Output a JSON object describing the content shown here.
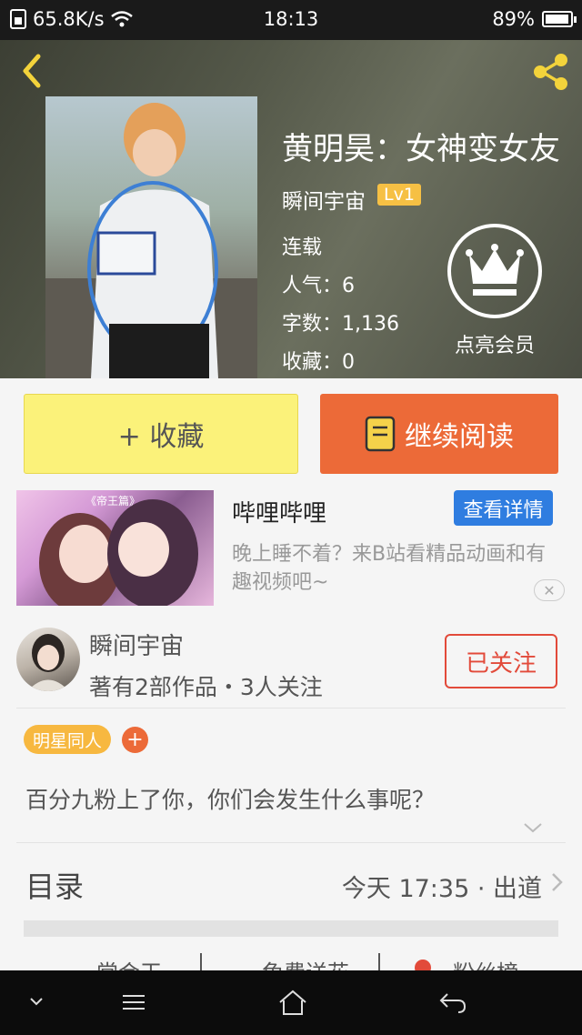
{
  "status_bar": {
    "speed": "65.8K/s",
    "time": "18:13",
    "battery": "89%"
  },
  "book": {
    "title": "黄明昊：女神变女友",
    "author": "瞬间宇宙",
    "level": "Lv1",
    "status": "连载",
    "popularity": "人气：6",
    "word_count": "字数：1,136",
    "favorites": "收藏：0",
    "vip_label": "点亮会员"
  },
  "actions": {
    "favorite": "+ 收藏",
    "continue_reading": "继续阅读"
  },
  "ad": {
    "image_text": "《帝王篇》",
    "title": "哔哩哔哩",
    "button": "查看详情",
    "description": "晚上睡不着？来B站看精品动画和有趣视频吧~"
  },
  "author_card": {
    "name": "瞬间宇宙",
    "stats": "著有2部作品・3人关注",
    "follow_button": "已关注"
  },
  "tags": {
    "tag": "明星同人",
    "add": "+"
  },
  "summary": "百分九粉上了你，你们会发生什么事呢？",
  "toc": {
    "label": "目录",
    "updated": "今天 17:35 · 出道"
  },
  "bottom_tabs": [
    "常会干",
    "免费送花",
    "粉丝榜"
  ],
  "colors": {
    "accent_orange": "#ec6a38",
    "favorite_yellow": "#fbf27a",
    "follow_red": "#e24a3a",
    "ad_blue": "#2f7de0",
    "tag_yellow": "#f7b840"
  }
}
